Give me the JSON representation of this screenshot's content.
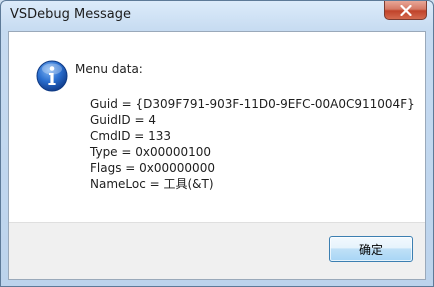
{
  "window": {
    "title": "VSDebug Message"
  },
  "message": {
    "heading": "Menu data:",
    "lines": [
      "Guid = {D309F791-903F-11D0-9EFC-00A0C911004F}",
      "GuidID = 4",
      "CmdID = 133",
      "Type = 0x00000100",
      "Flags = 0x00000000",
      "NameLoc = 工具(&T)"
    ]
  },
  "buttons": {
    "ok_label": "确定"
  },
  "icons": {
    "message_icon": "information-icon",
    "close_icon": "close-icon"
  },
  "colors": {
    "close_button": "#c7503a",
    "info_icon_blue": "#1f5fc0",
    "ok_button_border": "#3c7fb1"
  }
}
